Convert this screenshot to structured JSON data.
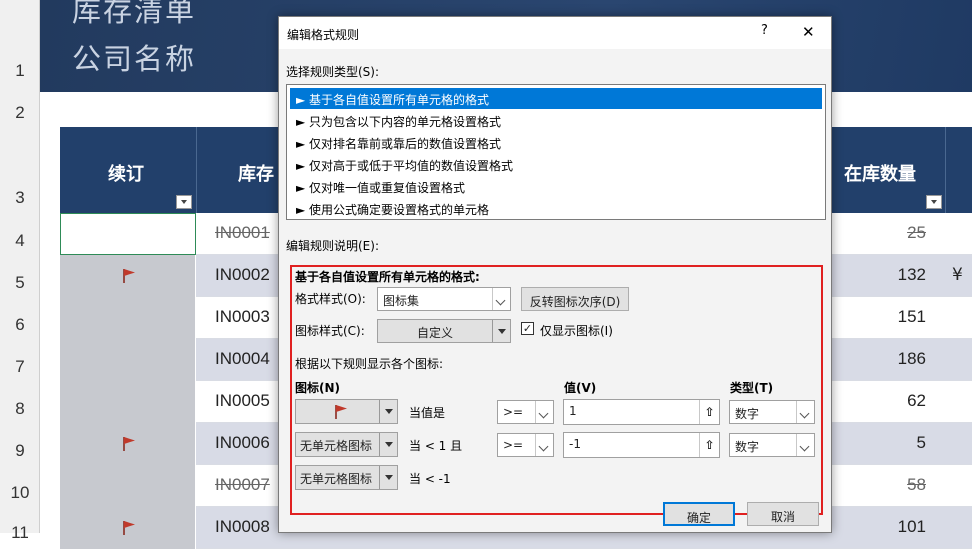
{
  "sheet": {
    "row_numbers": [
      "1",
      "2",
      "3",
      "4",
      "5",
      "6",
      "7",
      "8",
      "9",
      "10",
      "11"
    ],
    "banner_title": "库存清单",
    "banner_subtitle": "公司名称",
    "headers": {
      "renew": "续订",
      "id": "库存",
      "qty": "在库数量"
    },
    "rows": [
      {
        "id": "IN0001",
        "qty": "25",
        "struck": true,
        "flag": false,
        "alt": false
      },
      {
        "id": "IN0002",
        "qty": "132",
        "struck": false,
        "flag": true,
        "alt": true
      },
      {
        "id": "IN0003",
        "qty": "151",
        "struck": false,
        "flag": false,
        "alt": false
      },
      {
        "id": "IN0004",
        "qty": "186",
        "struck": false,
        "flag": false,
        "alt": true
      },
      {
        "id": "IN0005",
        "qty": "62",
        "struck": false,
        "flag": false,
        "alt": false
      },
      {
        "id": "IN0006",
        "qty": "5",
        "struck": false,
        "flag": true,
        "alt": true
      },
      {
        "id": "IN0007",
        "qty": "58",
        "struck": true,
        "flag": false,
        "alt": false
      },
      {
        "id": "IN0008",
        "qty": "101",
        "struck": false,
        "flag": true,
        "alt": true
      }
    ],
    "row2_extra": "¥"
  },
  "dialog": {
    "title": "编辑格式规则",
    "help": "?",
    "close": "✕",
    "select_type_label": "选择规则类型(S):",
    "rule_types": [
      "► 基于各自值设置所有单元格的格式",
      "► 只为包含以下内容的单元格设置格式",
      "► 仅对排名靠前或靠后的数值设置格式",
      "► 仅对高于或低于平均值的数值设置格式",
      "► 仅对唯一值或重复值设置格式",
      "► 使用公式确定要设置格式的单元格"
    ],
    "edit_desc_label": "编辑规则说明(E):",
    "group_title": "基于各自值设置所有单元格的格式:",
    "format_style_label": "格式样式(O):",
    "format_style_value": "图标集",
    "reverse_button": "反转图标次序(D)",
    "icon_style_label": "图标样式(C):",
    "icon_style_value": "自定义",
    "show_icon_only_label": "仅显示图标(I)",
    "show_icon_only_checked": true,
    "rules_desc": "根据以下规则显示各个图标:",
    "col_icon": "图标(N)",
    "col_value": "值(V)",
    "col_type": "类型(T)",
    "rule1_when": "当值是",
    "rule1_op": ">=",
    "rule1_value": "1",
    "rule1_type": "数字",
    "rule2_icon": "无单元格图标",
    "rule2_when": "当 < 1 且",
    "rule2_op": ">=",
    "rule2_value": "-1",
    "rule2_type": "数字",
    "rule3_icon": "无单元格图标",
    "rule3_when": "当 < -1",
    "ok": "确定",
    "cancel": "取消"
  },
  "colors": {
    "header_blue": "#22406b",
    "flag_red": "#c0392b",
    "selected": "#0078d7",
    "highlight_box": "#e02020"
  }
}
